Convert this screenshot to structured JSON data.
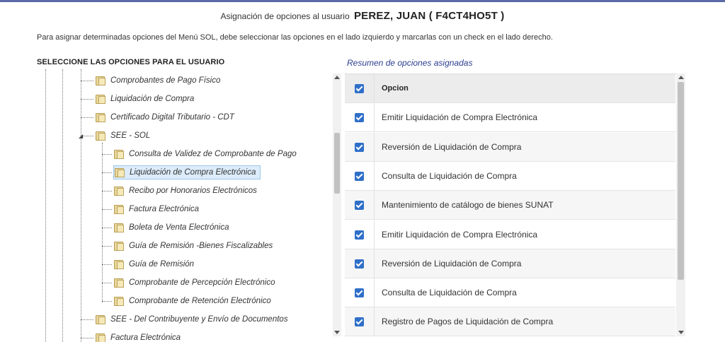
{
  "header": {
    "label": "Asignación de opciones al usuario",
    "user": "PEREZ, JUAN ( F4CT4HO5T )"
  },
  "instructions": "Para asignar determinadas opciones del Menú SOL, debe seleccionar las opciones en el lado izquierdo y marcarlas con un check en el lado derecho.",
  "left_panel": {
    "title": "SELECCIONE LAS OPCIONES PARA EL USUARIO",
    "tree_items": [
      {
        "label": "Comprobantes de Pago Físico",
        "level": 1,
        "icon": "folder-icon"
      },
      {
        "label": "Liquidación de Compra",
        "level": 1,
        "icon": "folder-icon"
      },
      {
        "label": "Certificado Digital Tributario - CDT",
        "level": 1,
        "icon": "folder-icon"
      },
      {
        "label": "SEE - SOL",
        "level": 1,
        "icon": "folder-icon",
        "expanded": true
      },
      {
        "label": "Consulta de Validez de Comprobante de Pago",
        "level": 2,
        "icon": "folder-icon"
      },
      {
        "label": "Liquidación de Compra Electrónica",
        "level": 2,
        "icon": "folder-icon",
        "selected": true
      },
      {
        "label": "Recibo por Honorarios Electrónicos",
        "level": 2,
        "icon": "folder-icon"
      },
      {
        "label": "Factura Electrónica",
        "level": 2,
        "icon": "folder-icon"
      },
      {
        "label": "Boleta de Venta Electrónica",
        "level": 2,
        "icon": "folder-icon"
      },
      {
        "label": "Guía de Remisión -Bienes Fiscalizables",
        "level": 2,
        "icon": "folder-icon"
      },
      {
        "label": "Guía de Remisión",
        "level": 2,
        "icon": "folder-icon"
      },
      {
        "label": "Comprobante de Percepción Electrónico",
        "level": 2,
        "icon": "folder-icon"
      },
      {
        "label": "Comprobante de Retención Electrónico",
        "level": 2,
        "icon": "folder-icon"
      },
      {
        "label": "SEE - Del Contribuyente y Envío de Documentos",
        "level": 1,
        "icon": "folder-icon"
      },
      {
        "label": "Factura Electrónica",
        "level": 1,
        "icon": "folder-icon"
      }
    ]
  },
  "right_panel": {
    "title": "Resumen de opciones asignadas",
    "column_header": "Opcion",
    "header_checked": true,
    "rows": [
      {
        "label": "Emitir Liquidación de Compra Electrónica",
        "checked": true
      },
      {
        "label": "Reversión de Liquidación de Compra",
        "checked": true
      },
      {
        "label": "Consulta de Liquidación de Compra",
        "checked": true
      },
      {
        "label": "Mantenimiento de catálogo de bienes SUNAT",
        "checked": true
      },
      {
        "label": "Emitir Liquidación de Compra Electrónica",
        "checked": true
      },
      {
        "label": "Reversión de Liquidación de Compra",
        "checked": true
      },
      {
        "label": "Consulta de Liquidación de Compra",
        "checked": true
      },
      {
        "label": "Registro de Pagos de Liquidación de Compra",
        "checked": true
      }
    ]
  },
  "colors": {
    "accent": "#2c3f8f",
    "checkbox": "#2f6fc9",
    "selection": "#dcecfa",
    "top_border": "#5b6aa6"
  }
}
